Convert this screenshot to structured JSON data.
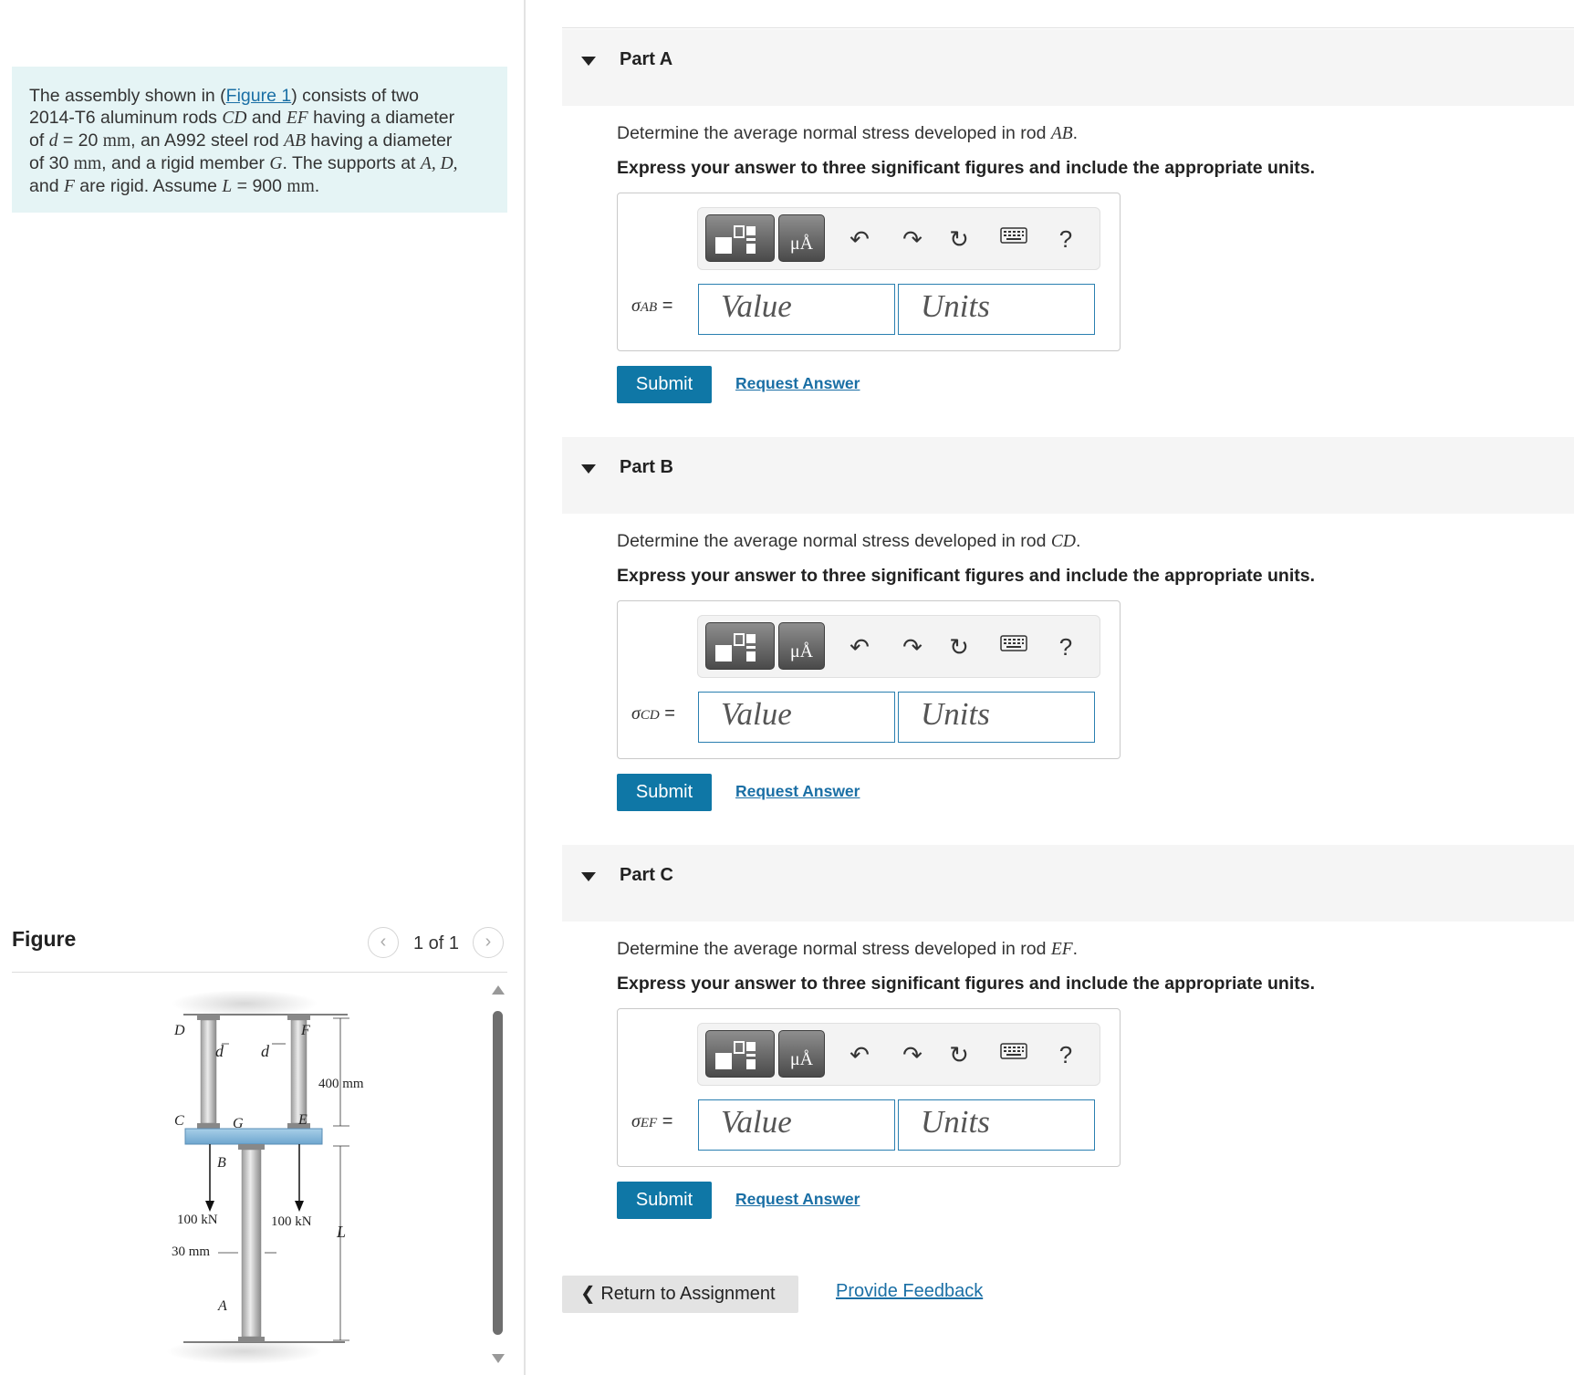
{
  "problem": {
    "text_1": "The assembly shown in (",
    "figure_link": "Figure 1",
    "text_2": ") consists of two",
    "text_3": "2014-T6 aluminum rods ",
    "cd": "CD",
    "text_4": " and ",
    "ef": "EF",
    "text_5": " having a diameter",
    "text_6": "of ",
    "d": "d",
    "text_7": " = 20 ",
    "mm": "mm",
    "text_8": ", an A992 steel rod ",
    "ab": "AB",
    "text_9": " having a diameter",
    "text_10": "of 30 ",
    "text_11": ", and a rigid member ",
    "g": "G",
    "text_12": ". The supports at ",
    "supports": "A, D,",
    "text_13": "and ",
    "f": "F",
    "text_14": " are rigid. Assume ",
    "l": "L",
    "text_15": " = 900 ",
    "text_16": "."
  },
  "figure": {
    "title": "Figure",
    "pager": "1 of 1",
    "labels": {
      "D": "D",
      "F": "F",
      "C": "C",
      "E": "E",
      "G": "G",
      "B": "B",
      "A": "A",
      "d1": "d",
      "d2": "d",
      "dim_400": "400 mm",
      "load_left": "100 kN",
      "load_right": "100 kN",
      "dim_30": "30 mm",
      "L": "L"
    }
  },
  "parts": [
    {
      "title": "Part A",
      "question_prefix": "Determine the average normal stress developed in rod ",
      "rod": "AB",
      "question_suffix": ".",
      "instruction": "Express your answer to three significant figures and include the appropriate units.",
      "sigma_symbol": "σ",
      "sigma_sub": "AB",
      "equals": "=",
      "value_placeholder": "Value",
      "units_placeholder": "Units",
      "submit": "Submit",
      "request": "Request Answer"
    },
    {
      "title": "Part B",
      "question_prefix": "Determine the average normal stress developed in rod ",
      "rod": "CD",
      "question_suffix": ".",
      "instruction": "Express your answer to three significant figures and include the appropriate units.",
      "sigma_symbol": "σ",
      "sigma_sub": "CD",
      "equals": "=",
      "value_placeholder": "Value",
      "units_placeholder": "Units",
      "submit": "Submit",
      "request": "Request Answer"
    },
    {
      "title": "Part C",
      "question_prefix": "Determine the average normal stress developed in rod ",
      "rod": "EF",
      "question_suffix": ".",
      "instruction": "Express your answer to three significant figures and include the appropriate units.",
      "sigma_symbol": "σ",
      "sigma_sub": "EF",
      "equals": "=",
      "value_placeholder": "Value",
      "units_placeholder": "Units",
      "submit": "Submit",
      "request": "Request Answer"
    }
  ],
  "toolbar": {
    "units_glyph": "μÅ",
    "undo": "↶",
    "redo": "↷",
    "reset": "↻",
    "keyboard": "⌨",
    "help": "?"
  },
  "footer": {
    "return_chevron": "❮",
    "return": "Return to Assignment",
    "feedback": "Provide Feedback"
  },
  "colors": {
    "problem_bg": "#e5f4f5",
    "accent": "#0f77a6",
    "link": "#1a6fa5"
  }
}
